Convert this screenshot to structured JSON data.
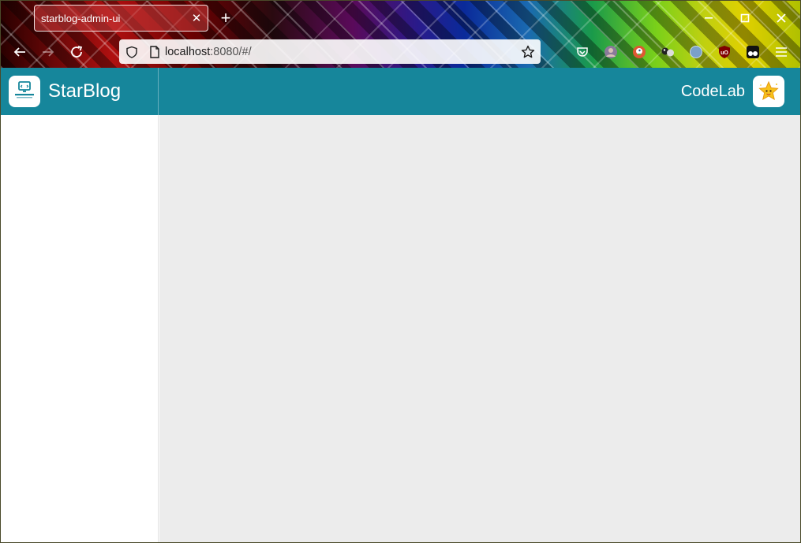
{
  "browser": {
    "tab": {
      "title": "starblog-admin-ui"
    },
    "url": {
      "host": "localhost",
      "rest": ":8080/#/"
    },
    "icons": {
      "back": "back-arrow-icon",
      "forward": "forward-arrow-icon",
      "reload": "reload-icon",
      "shield": "tracking-shield-icon",
      "page": "page-icon",
      "bookmark": "bookmark-star-icon",
      "pocket": "pocket-icon",
      "menu": "hamburger-menu-icon"
    }
  },
  "app": {
    "brand": {
      "name": "StarBlog"
    },
    "user": {
      "name": "CodeLab"
    },
    "colors": {
      "header": "#16869b",
      "main_bg": "#ececec",
      "sidebar_bg": "#ffffff"
    }
  }
}
